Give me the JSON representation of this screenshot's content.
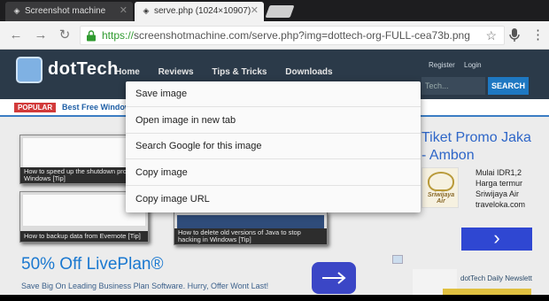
{
  "browser": {
    "tabs": [
      {
        "title": "Screenshot machine",
        "favicon": "globe-icon"
      },
      {
        "title": "serve.php (1024×10907)",
        "favicon": "globe-icon"
      }
    ],
    "url_scheme": "https://",
    "url_rest": "screenshotmachine.com/serve.php?img=dottech-org-FULL-cea73b.png",
    "icons": [
      "back-arrow-icon",
      "forward-arrow-icon",
      "reload-icon",
      "lock-icon",
      "star-icon",
      "mic-icon",
      "kebab-menu-icon"
    ]
  },
  "site": {
    "logo_text": "dotTech",
    "nav": [
      "Home",
      "Reviews",
      "Tips & Tricks",
      "Downloads"
    ],
    "user_links": [
      "Register",
      "Login"
    ],
    "search_placeholder": "Tech...",
    "search_button": "SEARCH",
    "popular_label": "POPULAR",
    "popular_link": "Best Free Window",
    "accent": "#1e78c2"
  },
  "thumbnails": [
    {
      "caption": "How to speed up the shutdown pro Windows [Tip]"
    },
    {
      "caption": "How to backup data from Evernote [Tip]"
    },
    {
      "caption": "How to delete old versions of Java to stop hacking in Windows [Tip]"
    }
  ],
  "ad_liveplan": {
    "headline": "50% Off LivePlan®",
    "subtitle": "Save Big On Leading Business Plan Software. Hurry, Offer Wont Last!"
  },
  "ad_travel": {
    "title_line1": "Tiket Promo Jaka",
    "title_line2": "- Ambon",
    "brand": "Sriwijaya Air",
    "text_lines": [
      "Mulai IDR1,2",
      "Harga termur",
      "Sriwijaya Air",
      "traveloka.com"
    ],
    "newsletter": "dotTech Daily Newslett"
  },
  "context_menu": {
    "items": [
      "Save image",
      "Open image in new tab",
      "Search Google for this image",
      "Copy image",
      "Copy image URL"
    ]
  }
}
